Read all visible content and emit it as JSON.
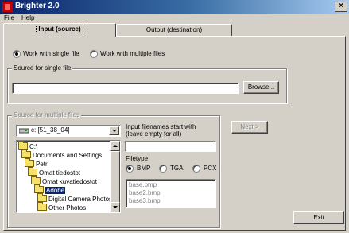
{
  "window": {
    "title": "Brighter 2.0",
    "close_label": "×"
  },
  "menu": {
    "file": {
      "accel": "F",
      "rest": "ile"
    },
    "help": {
      "accel": "H",
      "rest": "elp"
    }
  },
  "tabs": [
    {
      "label": "Input (source)",
      "active": true
    },
    {
      "label": "Output (destination)",
      "active": false
    }
  ],
  "mode": {
    "single_label": "Work with single file",
    "multiple_label": "Work with multiple files",
    "selected": "single"
  },
  "single_source": {
    "group_label": "Source for single file",
    "path_value": "",
    "browse_label": "Browse..."
  },
  "multiple_source": {
    "group_label": "Source for multiple files",
    "drive": "c: [51_38_04]",
    "directories": [
      {
        "label": "C:\\",
        "selected": false
      },
      {
        "label": "Documents and Settings",
        "selected": false
      },
      {
        "label": "Petri",
        "selected": false
      },
      {
        "label": "Omat tiedostot",
        "selected": false
      },
      {
        "label": "Omat kuvatiedostot",
        "selected": false
      },
      {
        "label": "Adobe",
        "selected": true
      },
      {
        "label": "Digital Camera Photos",
        "selected": false
      },
      {
        "label": "Other Photos",
        "selected": false
      }
    ],
    "filename_label_line1": "Input filenames start with",
    "filename_label_line2": "(leave empty for all)",
    "filename_value": "",
    "filetype_label": "Filetype",
    "filetypes": [
      {
        "label": "BMP",
        "selected": true
      },
      {
        "label": "TGA",
        "selected": false
      },
      {
        "label": "PCX",
        "selected": false
      }
    ],
    "files": [
      "base.bmp",
      "base2.bmp",
      "base3.bmp"
    ]
  },
  "buttons": {
    "next": "Next >",
    "exit": "Exit"
  },
  "colors": {
    "titlebar_start": "#0a246a",
    "titlebar_end": "#a6caf0",
    "selection": "#0a246a",
    "face": "#d4d0c8"
  }
}
